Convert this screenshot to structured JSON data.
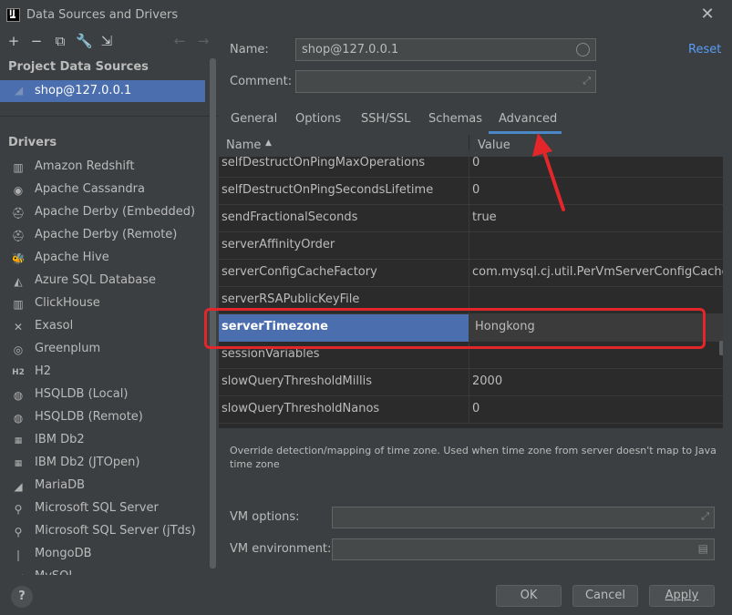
{
  "window": {
    "title": "Data Sources and Drivers",
    "logo_text": "IJ"
  },
  "left": {
    "project_section_title": "Project Data Sources",
    "data_source": "shop@127.0.0.1",
    "drivers_section_title": "Drivers",
    "drivers": [
      {
        "label": "Amazon Redshift",
        "icon": "▥"
      },
      {
        "label": "Apache Cassandra",
        "icon": "◉"
      },
      {
        "label": "Apache Derby (Embedded)",
        "icon": "⛑"
      },
      {
        "label": "Apache Derby (Remote)",
        "icon": "⛑"
      },
      {
        "label": "Apache Hive",
        "icon": "🐝"
      },
      {
        "label": "Azure SQL Database",
        "icon": "◭"
      },
      {
        "label": "ClickHouse",
        "icon": "▥"
      },
      {
        "label": "Exasol",
        "icon": "✕"
      },
      {
        "label": "Greenplum",
        "icon": "◎"
      },
      {
        "label": "H2",
        "icon": "H2"
      },
      {
        "label": "HSQLDB (Local)",
        "icon": "◍"
      },
      {
        "label": "HSQLDB (Remote)",
        "icon": "◍"
      },
      {
        "label": "IBM Db2",
        "icon": "▦"
      },
      {
        "label": "IBM Db2 (JTOpen)",
        "icon": "▦"
      },
      {
        "label": "MariaDB",
        "icon": "◢"
      },
      {
        "label": "Microsoft SQL Server",
        "icon": "⚲"
      },
      {
        "label": "Microsoft SQL Server (jTds)",
        "icon": "⚲"
      },
      {
        "label": "MongoDB",
        "icon": "❘"
      },
      {
        "label": "MySQL",
        "icon": "◢"
      }
    ]
  },
  "form": {
    "name_label": "Name:",
    "name_value": "shop@127.0.0.1",
    "comment_label": "Comment:",
    "comment_value": "",
    "reset_label": "Reset"
  },
  "tabs": [
    "General",
    "Options",
    "SSH/SSL",
    "Schemas",
    "Advanced"
  ],
  "active_tab": "Advanced",
  "table": {
    "col_name": "Name",
    "col_value": "Value",
    "rows": [
      {
        "name": "selfDestructOnPingMaxOperations",
        "value": "0"
      },
      {
        "name": "selfDestructOnPingSecondsLifetime",
        "value": "0"
      },
      {
        "name": "sendFractionalSeconds",
        "value": "true"
      },
      {
        "name": "serverAffinityOrder",
        "value": ""
      },
      {
        "name": "serverConfigCacheFactory",
        "value": "com.mysql.cj.util.PerVmServerConfigCacheFa..."
      },
      {
        "name": "serverRSAPublicKeyFile",
        "value": ""
      },
      {
        "name": "serverTimezone",
        "value": "Hongkong"
      },
      {
        "name": "sessionVariables",
        "value": ""
      },
      {
        "name": "slowQueryThresholdMillis",
        "value": "2000"
      },
      {
        "name": "slowQueryThresholdNanos",
        "value": "0"
      }
    ],
    "selected_row": "serverTimezone"
  },
  "description": "Override detection/mapping of time zone. Used when time zone from server doesn't map to Java time zone",
  "vm": {
    "options_label": "VM options:",
    "options_value": "",
    "environment_label": "VM environment:",
    "environment_value": ""
  },
  "buttons": {
    "help": "?",
    "ok": "OK",
    "cancel": "Cancel",
    "apply": "Apply"
  },
  "colors": {
    "selection": "#4b6eaf",
    "highlight": "#e3262a",
    "link": "#589df6",
    "tab_underline": "#4a88c7"
  }
}
